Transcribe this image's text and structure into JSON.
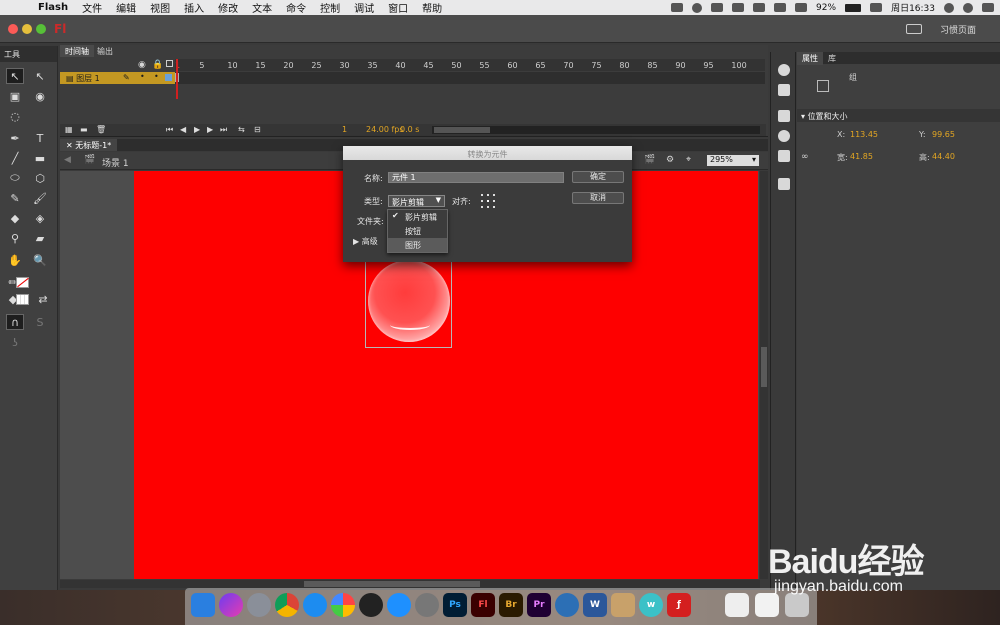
{
  "menubar": {
    "app": "Flash",
    "items": [
      "文件",
      "编辑",
      "视图",
      "插入",
      "修改",
      "文本",
      "命令",
      "控制",
      "调试",
      "窗口",
      "帮助"
    ],
    "battery": "92%",
    "clock": "周日16:33"
  },
  "titlebar": {
    "app_badge": "Fl",
    "workspace": "习惯页面"
  },
  "tools": {
    "title": "工具"
  },
  "timeline": {
    "tabs": [
      "时间轴",
      "输出"
    ],
    "ruler_ticks": [
      "1",
      "5",
      "10",
      "15",
      "20",
      "25",
      "30",
      "35",
      "40",
      "45",
      "50",
      "55",
      "60",
      "65",
      "70",
      "75",
      "80",
      "85",
      "90",
      "95",
      "100"
    ],
    "layer_name": "图层 1",
    "current_frame": "1",
    "fps": "24.00 fps",
    "time": "0.0 s"
  },
  "document": {
    "tab": "无标题-1*",
    "scene": "场景 1",
    "zoom": "295%",
    "stage_color": "#fe0000"
  },
  "properties": {
    "tabs": [
      "属性",
      "库"
    ],
    "instance_type": "组",
    "section": "位置和大小",
    "x_label": "X:",
    "x_value": "113.45",
    "y_label": "Y:",
    "y_value": "99.65",
    "w_label": "宽:",
    "w_value": "41.85",
    "h_label": "高:",
    "h_value": "44.40",
    "value_color": "#e3a623"
  },
  "dialog": {
    "title": "转换为元件",
    "name_label": "名称:",
    "name_value": "元件 1",
    "type_label": "类型:",
    "type_value": "影片剪辑",
    "align_label": "对齐:",
    "folder_label": "文件夹:",
    "advanced_label": "高级",
    "ok": "确定",
    "cancel": "取消",
    "type_options": [
      "影片剪辑",
      "按钮",
      "图形"
    ]
  },
  "dock": {
    "apps": [
      "finder-icon",
      "siri-icon",
      "launchpad-icon",
      "chrome-icon",
      "safari-icon",
      "photos-icon",
      "qq-icon",
      "appstore-icon",
      "system-preferences-icon",
      "Ps",
      "Fl",
      "Br",
      "Pr",
      "quicktime-icon",
      "word-icon",
      "archive-icon",
      "wunderlist-icon",
      "flash-player-icon",
      "preview-icon",
      "screenshot-icon",
      "trash-icon"
    ]
  },
  "watermark": {
    "logo_text": "Baidu经验",
    "url": "jingyan.baidu.com"
  }
}
